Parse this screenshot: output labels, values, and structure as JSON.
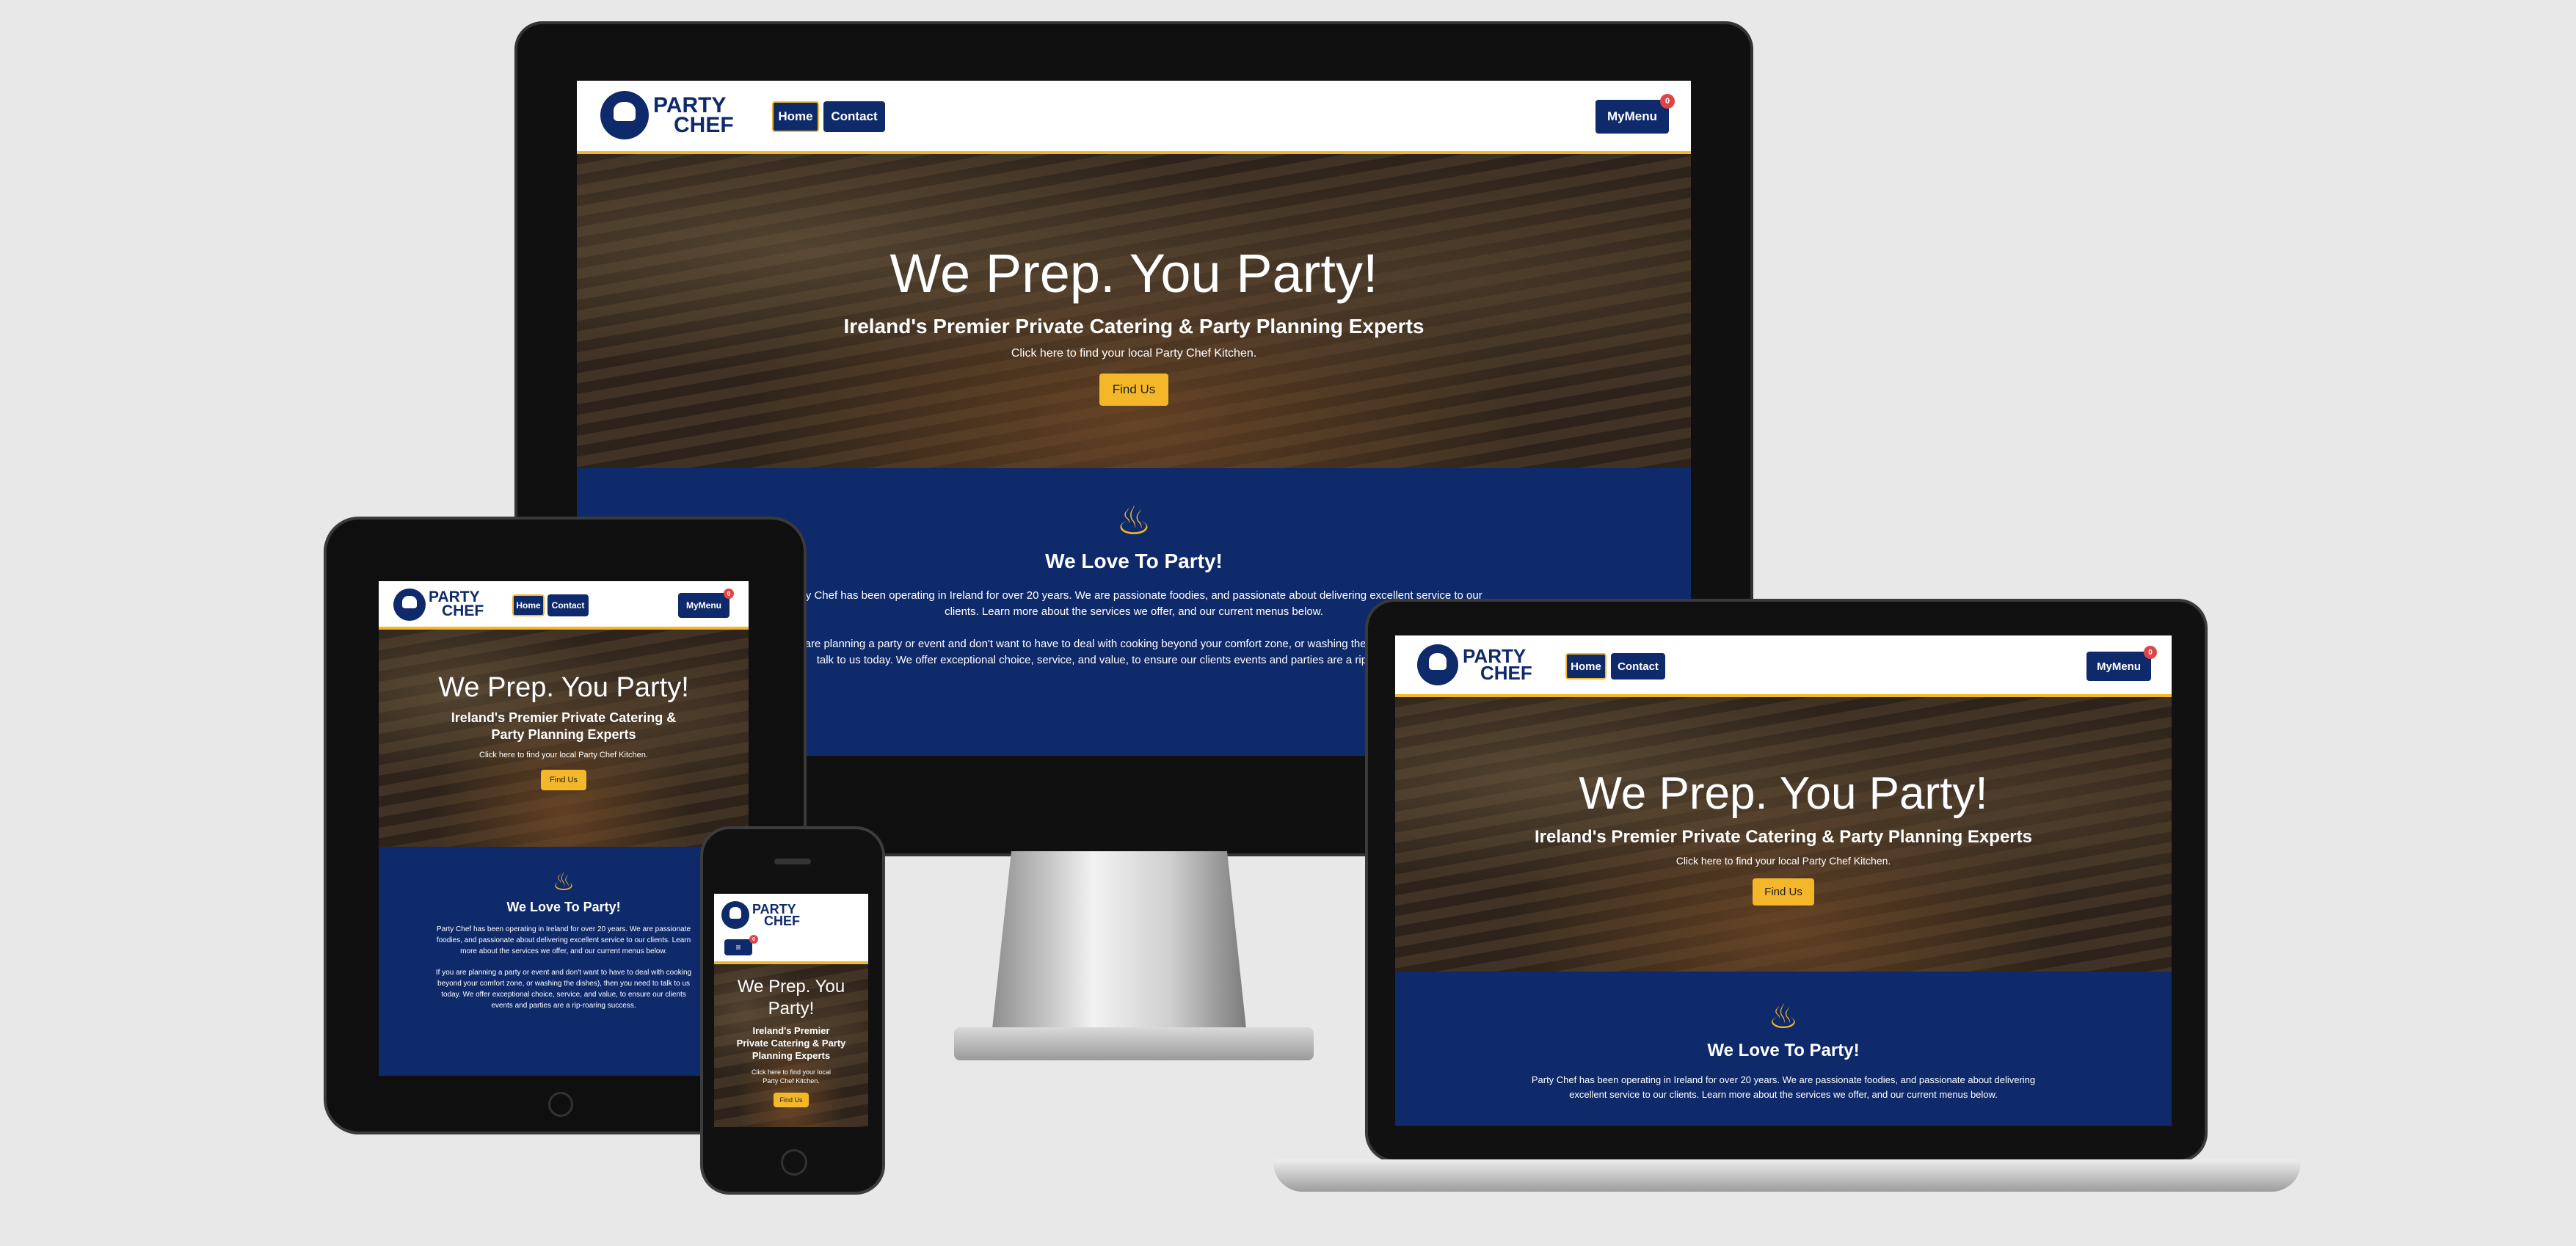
{
  "site": {
    "logo": {
      "line1": "PARTY",
      "line2": "CHEF"
    },
    "nav": {
      "home": "Home",
      "contact": "Contact",
      "mymenu": "MyMenu",
      "cart_count": "0"
    },
    "hero": {
      "title": "We Prep. You Party!",
      "subtitle": "Ireland's Premier Private Catering & Party Planning Experts",
      "text": "Click here to find your local Party Chef Kitchen.",
      "button": "Find Us"
    },
    "about": {
      "icon": "birthday-cake-icon",
      "heading": "We Love To Party!",
      "p1": "Party Chef has been operating in Ireland for over 20 years. We are passionate foodies, and passionate about delivering excellent service to our clients. Learn more about the services we offer, and our current menus below.",
      "p2": "If you are planning a party or event and don't want to have to deal with cooking beyond your comfort zone, or washing the dishes), then you need to talk to us today. We offer exceptional choice, service, and value, to ensure our clients events and parties are a rip-roaring success."
    }
  },
  "colors": {
    "brand": "#0e2a6b",
    "accent": "#f4b72a",
    "badge": "#e04545"
  }
}
